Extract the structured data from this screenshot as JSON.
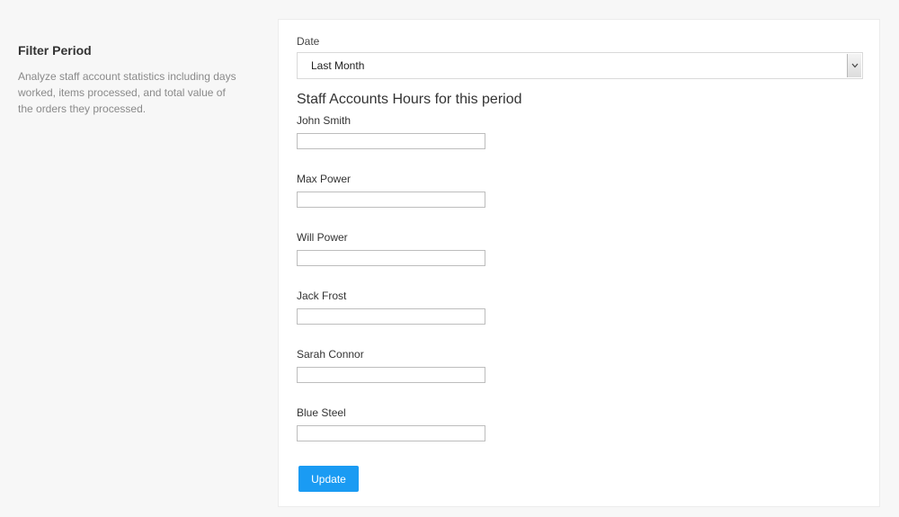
{
  "sidebar": {
    "title": "Filter Period",
    "description": "Analyze staff account statistics including days worked, items processed, and total value of the orders they processed."
  },
  "form": {
    "date_label": "Date",
    "date_selected": "Last Month",
    "section_heading": "Staff Accounts Hours for this period",
    "staff": [
      {
        "name": "John Smith",
        "value": ""
      },
      {
        "name": "Max Power",
        "value": ""
      },
      {
        "name": "Will Power",
        "value": ""
      },
      {
        "name": "Jack Frost",
        "value": ""
      },
      {
        "name": "Sarah Connor",
        "value": ""
      },
      {
        "name": "Blue Steel",
        "value": ""
      }
    ],
    "update_label": "Update"
  },
  "colors": {
    "accent": "#1a9bf3",
    "background": "#f7f7f7",
    "card": "#ffffff"
  },
  "icons": {
    "select_arrow": "chevron-down-icon"
  }
}
